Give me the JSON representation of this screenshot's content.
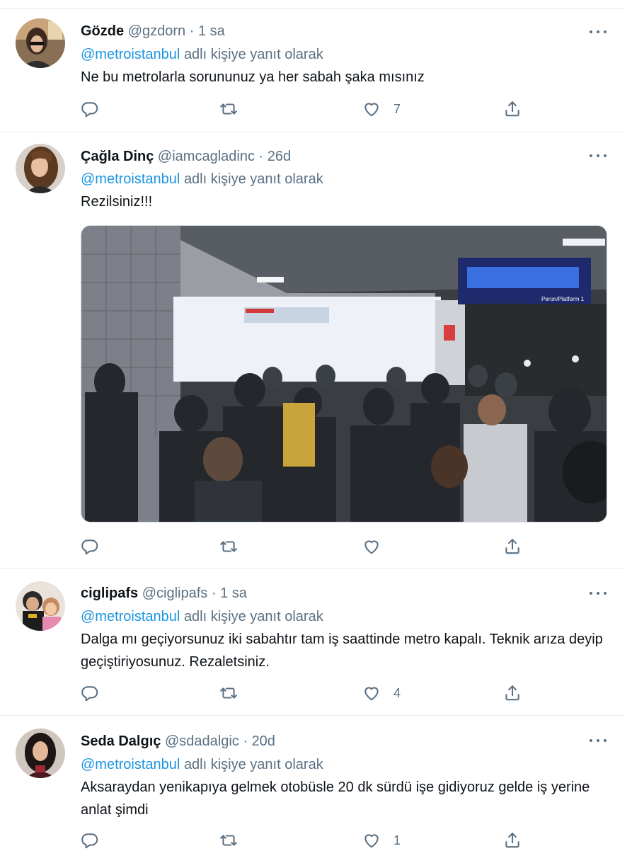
{
  "replying_label": "adlı kişiye yanıt olarak",
  "tweets": [
    {
      "name": "Gözde",
      "handle": "@gzdorn",
      "time": "1 sa",
      "reply_to": "@metroistanbul",
      "text": "Ne bu metrolarla sorununuz ya her sabah şaka mısınız",
      "likes": "7"
    },
    {
      "name": "Çağla Dinç",
      "handle": "@iamcagladinc",
      "time": "26d",
      "reply_to": "@metroistanbul",
      "text": "Rezilsiniz!!!",
      "likes": "",
      "media_sign": "Peron/Platform 1"
    },
    {
      "name": "ciglipafs",
      "handle": "@ciglipafs",
      "time": "1 sa",
      "reply_to": "@metroistanbul",
      "text": "Dalga mı geçiyorsunuz iki sabahtır tam iş saattinde metro kapalı. Teknik arıza deyip geçiştiriyosunuz. Rezaletsiniz.",
      "likes": "4"
    },
    {
      "name": "Seda Dalgıç",
      "handle": "@sdadalgic",
      "time": "20d",
      "reply_to": "@metroistanbul",
      "text": "Aksaraydan yenikapıya gelmek otobüsle 20 dk sürdü işe gidiyoruz gelde iş yerine anlat şimdi",
      "likes": "1"
    }
  ],
  "icons": {
    "reply": "reply-icon",
    "retweet": "retweet-icon",
    "like": "heart-icon",
    "share": "share-icon",
    "more": "more-icon"
  },
  "colors": {
    "link": "#1b95e0",
    "secondary_text": "#5b7083",
    "border": "#e6ecf0"
  }
}
